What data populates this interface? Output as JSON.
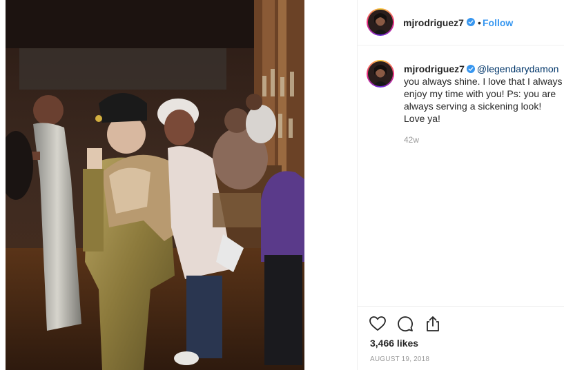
{
  "post": {
    "username": "mjrodriguez7",
    "follow_label": "Follow",
    "separator": "•"
  },
  "comment": {
    "username": "mjrodriguez7",
    "mention": "@legendarydamon",
    "text": " you always shine. I love that I always enjoy my time with you! Ps: you are always serving a sickening look! Love ya!",
    "age": "42w"
  },
  "stats": {
    "likes": "3,466 likes",
    "date": "AUGUST 19, 2018"
  },
  "icons": {
    "verified": "verified-badge-icon",
    "like": "heart-icon",
    "comment": "comment-bubble-icon",
    "share": "share-icon"
  },
  "colors": {
    "verified_blue": "#3897f0",
    "follow_blue": "#3897f0",
    "mention": "#003569",
    "muted_text": "#999999",
    "text": "#262626"
  }
}
